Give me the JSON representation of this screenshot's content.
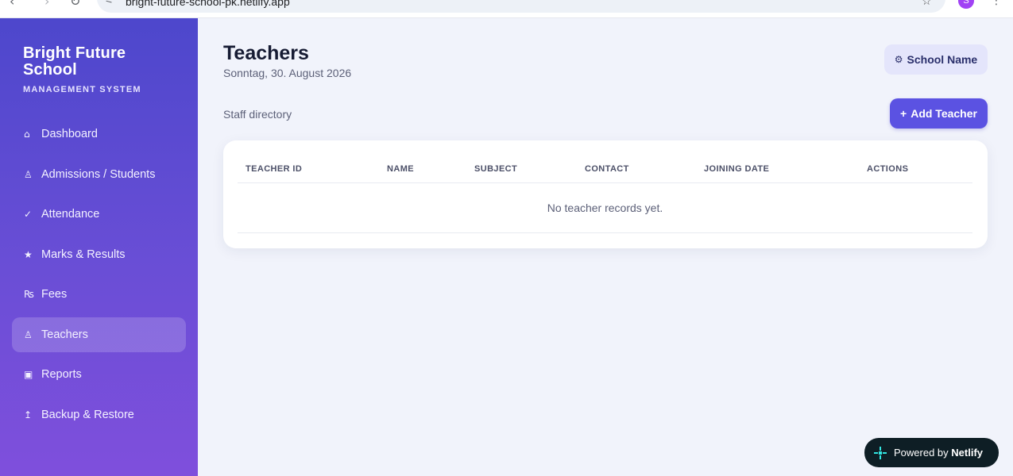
{
  "browser": {
    "url": "bright-future-school-pk.netlify.app",
    "profile_initial": "S",
    "icons": [
      "back-arrow-icon",
      "forward-arrow-icon",
      "reload-icon",
      "site-settings-icon",
      "bookmark-star-icon",
      "more-menu-icon"
    ]
  },
  "sidebar": {
    "brand_title": "Bright Future School",
    "brand_subtitle": "MANAGEMENT SYSTEM",
    "items": [
      {
        "label": "Dashboard",
        "icon": "⌂",
        "icon_name": "home-icon",
        "active": false
      },
      {
        "label": "Admissions / Students",
        "icon": "♙",
        "icon_name": "student-icon",
        "active": false
      },
      {
        "label": "Attendance",
        "icon": "✓",
        "icon_name": "check-icon",
        "active": false
      },
      {
        "label": "Marks & Results",
        "icon": "★",
        "icon_name": "star-icon",
        "active": false
      },
      {
        "label": "Fees",
        "icon": "₨",
        "icon_name": "rupee-icon",
        "active": false
      },
      {
        "label": "Teachers",
        "icon": "♙",
        "icon_name": "teacher-icon",
        "active": true
      },
      {
        "label": "Reports",
        "icon": "▣",
        "icon_name": "report-icon",
        "active": false
      },
      {
        "label": "Backup & Restore",
        "icon": "↥",
        "icon_name": "upload-icon",
        "active": false
      }
    ],
    "colors": {
      "gradient_top": "#4d47cc",
      "gradient_bottom": "#7f4fdc"
    }
  },
  "header": {
    "title": "Teachers",
    "date": "Sonntag, 30. August 2026",
    "school_button": {
      "icon": "⚙",
      "label": "School Name"
    }
  },
  "toolbar": {
    "section_label": "Staff directory",
    "add_button": {
      "icon": "+",
      "label": "Add Teacher"
    }
  },
  "table": {
    "columns": [
      "TEACHER ID",
      "NAME",
      "SUBJECT",
      "CONTACT",
      "JOINING DATE",
      "ACTIONS"
    ],
    "rows": [],
    "empty_text": "No teacher records yet."
  },
  "badge": {
    "prefix": "Powered by",
    "brand": "Netlify"
  },
  "colors": {
    "accent": "#5b52e2",
    "background": "#f1f3fb",
    "netlify_badge": "#0e1e25"
  }
}
